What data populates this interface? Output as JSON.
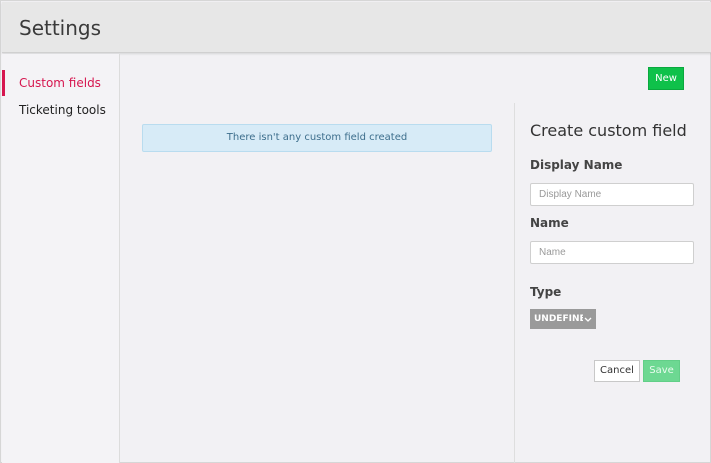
{
  "header": {
    "title": "Settings"
  },
  "sidebar": {
    "items": [
      {
        "label": "Custom fields",
        "active": true
      },
      {
        "label": "Ticketing tools",
        "active": false
      }
    ]
  },
  "toolbar": {
    "new_label": "New"
  },
  "main": {
    "empty_message": "There isn't any custom field created"
  },
  "form": {
    "title": "Create custom field",
    "display_name_label": "Display Name",
    "display_name_placeholder": "Display Name",
    "name_label": "Name",
    "name_placeholder": "Name",
    "type_label": "Type",
    "type_value": "UNDEFINED",
    "cancel_label": "Cancel",
    "save_label": "Save"
  },
  "colors": {
    "accent": "#d6164f",
    "new_button": "#0fc14a",
    "save_button_disabled": "#6dd892",
    "alert_bg": "#d7ebf7"
  },
  "icons": {
    "type_dropdown": "chevron-down-icon"
  }
}
